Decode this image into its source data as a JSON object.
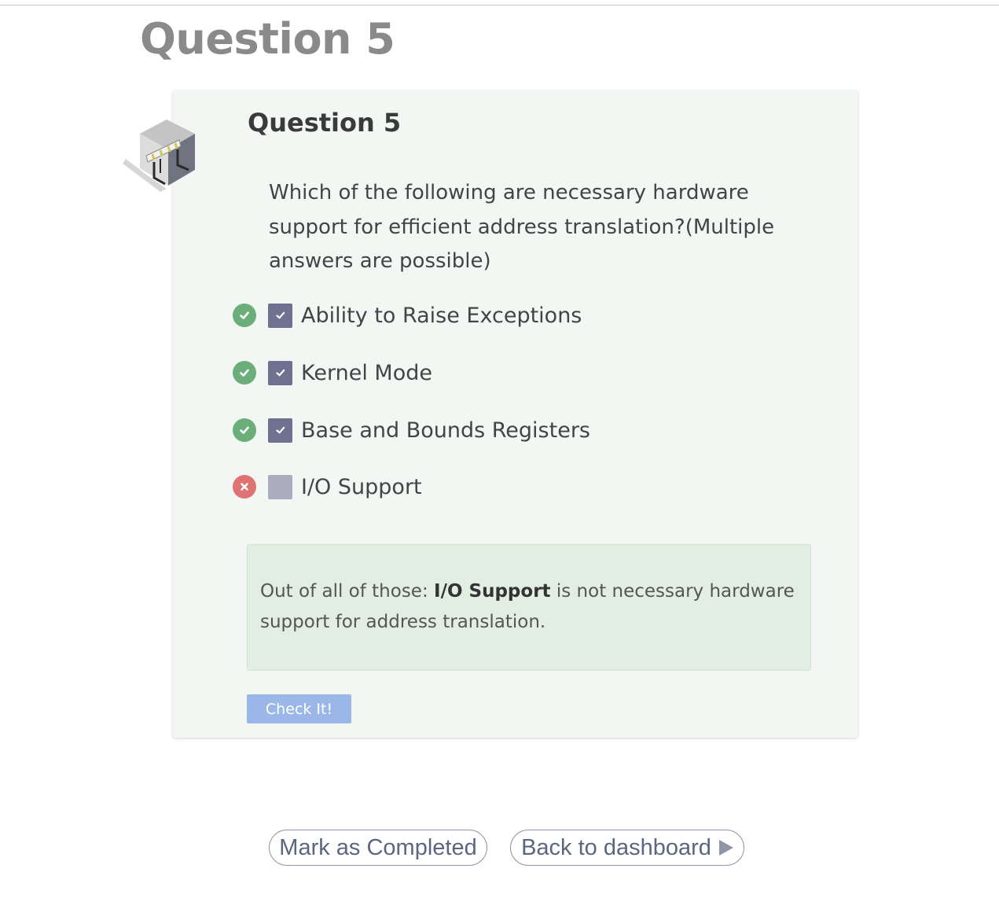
{
  "page": {
    "title": "Question 5"
  },
  "card": {
    "title": "Question 5",
    "question": "Which of the following are necessary hardware support for efficient address translation?(Multiple answers are possible)",
    "options": [
      {
        "label": "Ability to Raise Exceptions",
        "checked": true,
        "status": "correct"
      },
      {
        "label": "Kernel Mode",
        "checked": true,
        "status": "correct"
      },
      {
        "label": "Base and Bounds Registers",
        "checked": true,
        "status": "correct"
      },
      {
        "label": "I/O Support",
        "checked": false,
        "status": "incorrect"
      }
    ],
    "feedback": {
      "prefix": "Out of all of those: ",
      "highlight": "I/O Support",
      "suffix": " is not necessary hardware support for address translation."
    },
    "check_button": "Check It!"
  },
  "footer": {
    "mark_completed": "Mark as Completed",
    "back_to_dashboard": "Back to dashboard"
  },
  "colors": {
    "correct": "#6cae7a",
    "incorrect": "#df7373",
    "checkbox_checked": "#6e7190",
    "checkbox_unchecked": "#abadbf",
    "card_background": "#f3f7f4",
    "feedback_background": "#e2eee2",
    "button": "#9bb7e7"
  },
  "icons": {
    "lesson": "hardware-block-icon",
    "correct": "check-circle-icon",
    "incorrect": "x-circle-icon",
    "checkbox": "checkmark-icon",
    "next": "play-arrow-icon"
  }
}
